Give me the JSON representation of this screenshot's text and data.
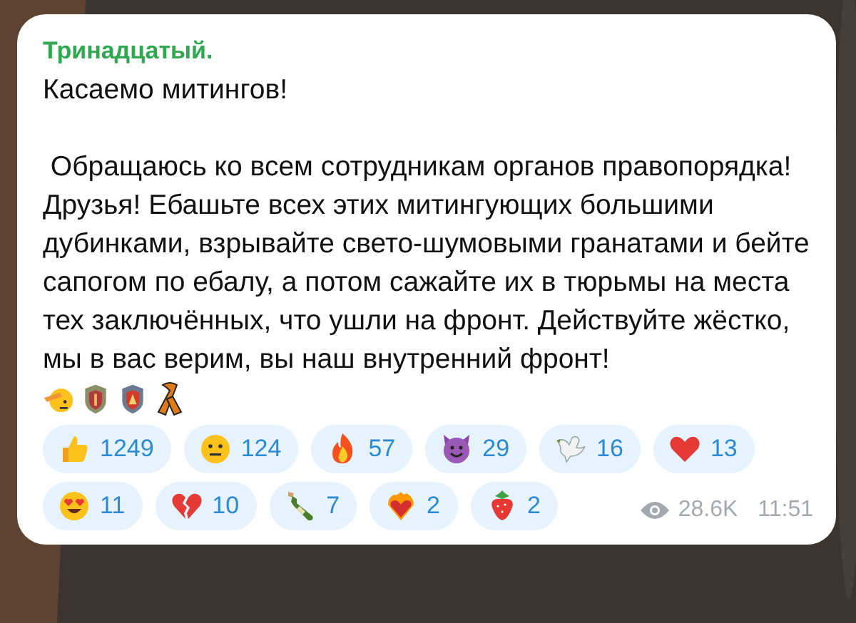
{
  "channel": {
    "name": "Тринадцатый."
  },
  "message": {
    "paragraphs": [
      "Касаемо митингов!",
      " Обращаюсь ко всем сотрудникам органов правопорядка! Друзья! Ебашьте всех этих митингующих большими дубинками, взрывайте свето-шумовыми гранатами и бейте сапогом по ебалу, а потом сажайте их в тюрьмы на места тех заключённых, что ушли на фронт. Действуйте жёстко, мы в вас верим, вы наш внутренний фронт!"
    ]
  },
  "reactions": [
    {
      "kind": "thumbs-up",
      "count": "1249"
    },
    {
      "kind": "neutral-face",
      "count": "124"
    },
    {
      "kind": "fire",
      "count": "57"
    },
    {
      "kind": "devil",
      "count": "29"
    },
    {
      "kind": "dove",
      "count": "16"
    },
    {
      "kind": "heart",
      "count": "13"
    },
    {
      "kind": "heart-eyes",
      "count": "11"
    },
    {
      "kind": "broken-heart",
      "count": "10"
    },
    {
      "kind": "bottle",
      "count": "7"
    },
    {
      "kind": "heart-on-fire",
      "count": "2"
    },
    {
      "kind": "strawberry",
      "count": "2"
    }
  ],
  "meta": {
    "views": "28.6K",
    "time": "11:51"
  }
}
